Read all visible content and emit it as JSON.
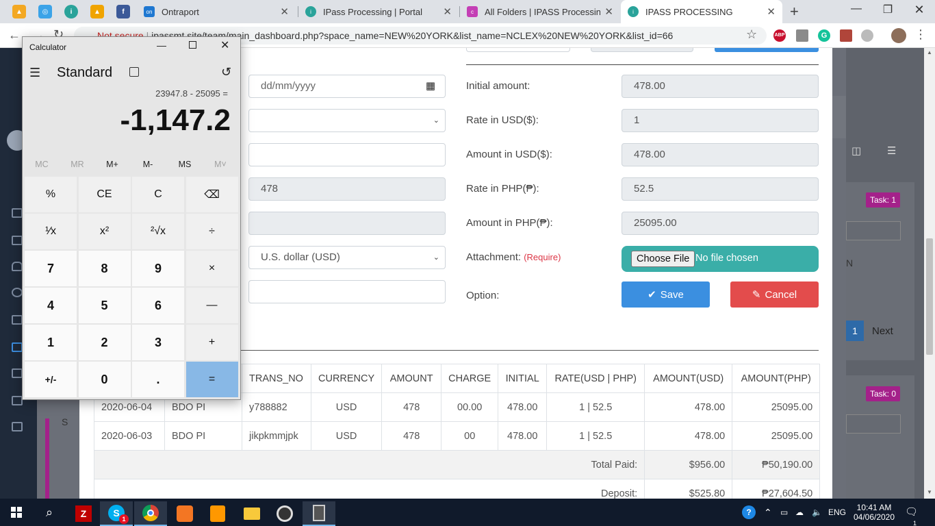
{
  "browser": {
    "tabs": [
      {
        "title": "Ontraport"
      },
      {
        "title": "IPass Processing | Portal"
      },
      {
        "title": "All Folders | IPASS Processing (Li"
      },
      {
        "title": "IPASS PROCESSING"
      }
    ],
    "url_prefix": "Not secure",
    "url": "ipassmt.site/team/main_dashboard.php?space_name=NEW%20YORK&list_name=NCLEX%20NEW%20YORK&list_id=66",
    "new_tab_label": "+",
    "ext_abp": "ABP",
    "ext_g": "G"
  },
  "calculator": {
    "window_title": "Calculator",
    "mode": "Standard",
    "expression": "23947.8 - 25095 =",
    "display": "-1,147.2",
    "memory": [
      "MC",
      "MR",
      "M+",
      "M-",
      "MS",
      "M˅"
    ],
    "keys": [
      "%",
      "CE",
      "C",
      "⌫",
      "¹⁄x",
      "x²",
      "²√x",
      "÷",
      "7",
      "8",
      "9",
      "×",
      "4",
      "5",
      "6",
      "—",
      "1",
      "2",
      "3",
      "+",
      "+/-",
      "0",
      ".",
      "="
    ]
  },
  "form": {
    "date_placeholder": "dd/mm/yyyy",
    "amount_value": "478",
    "currency_value": "U.S. dollar (USD)",
    "initial_amount_label": "Initial amount:",
    "initial_amount_value": "478.00",
    "rate_usd_label": "Rate in USD($):",
    "rate_usd_value": "1",
    "amount_usd_label": "Amount in USD($):",
    "amount_usd_value": "478.00",
    "rate_php_label": "Rate in PHP(₱):",
    "rate_php_value": "52.5",
    "amount_php_label": "Amount in PHP(₱):",
    "amount_php_value": "25095.00",
    "attachment_label": "Attachment:",
    "attachment_required": "(Require)",
    "choose_file_label": "Choose File",
    "no_file_label": "No file chosen",
    "option_label": "Option:",
    "save_label": "Save",
    "cancel_label": "Cancel"
  },
  "table": {
    "headers": [
      "TRANS_NO",
      "CURRENCY",
      "AMOUNT",
      "CHARGE",
      "INITIAL",
      "RATE(USD | PHP)",
      "AMOUNT(USD)",
      "AMOUNT(PHP)"
    ],
    "rows": [
      {
        "date": "2020-06-04",
        "bank": "BDO PI",
        "trans_no": "y788882",
        "currency": "USD",
        "amount": "478",
        "charge": "00.00",
        "initial": "478.00",
        "rate": "1 | 52.5",
        "amount_usd": "478.00",
        "amount_php": "25095.00"
      },
      {
        "date": "2020-06-03",
        "bank": "BDO PI",
        "trans_no": "jikpkmmjpk",
        "currency": "USD",
        "amount": "478",
        "charge": "00",
        "initial": "478.00",
        "rate": "1 | 52.5",
        "amount_usd": "478.00",
        "amount_php": "25095.00"
      }
    ],
    "total_paid_label": "Total Paid:",
    "total_paid_usd": "$956.00",
    "total_paid_php": "₱50,190.00",
    "deposit_label": "Deposit:",
    "deposit_usd": "$525.80",
    "deposit_php": "₱27,604.50"
  },
  "right_panel": {
    "task1_label": "Task: 1",
    "task0_label": "Task: 0",
    "page_number": "1",
    "next_label": "Next",
    "n_letter": "N",
    "s_letter": "S"
  },
  "taskbar": {
    "lang": "ENG",
    "time": "10:41 AM",
    "date": "04/06/2020",
    "notif_count": "1",
    "skype_badge": "1"
  },
  "colors": {
    "save_blue": "#3b8fe0",
    "cancel_red": "#e34c4c",
    "file_teal": "#3aaea8",
    "task_badge": "#a4218a",
    "calc_equals": "#88b8e6"
  }
}
